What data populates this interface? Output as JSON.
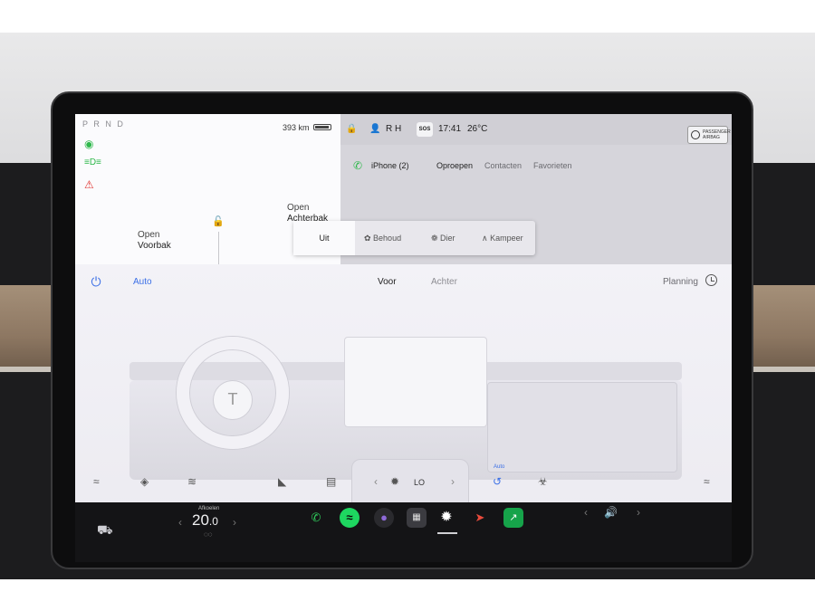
{
  "status": {
    "gears": "P R N D",
    "range": "393 km",
    "frunk": {
      "state": "Open",
      "name": "Voorbak"
    },
    "trunk": {
      "state": "Open",
      "name": "Achterbak"
    }
  },
  "top_bar": {
    "profile": "R H",
    "sos": "SOS",
    "time": "17:41",
    "outside_temp": "26°C",
    "airbag_label": "PASSENGER AIRBAG"
  },
  "phone": {
    "device": "iPhone (2)",
    "tabs": [
      "Oproepen",
      "Contacten",
      "Favorieten"
    ],
    "active_tab": "Oproepen"
  },
  "climate_keeper": {
    "options": [
      "Uit",
      "Behoud",
      "Dier",
      "Kampeer"
    ],
    "selected": "Uit"
  },
  "climate": {
    "auto_label": "Auto",
    "front_label": "Voor",
    "rear_label": "Achter",
    "planning_label": "Planning",
    "fan_speed": "LO",
    "auto_recirc_label": "Auto"
  },
  "taskbar": {
    "temp_label": "Afkoelen",
    "temp_value": "20",
    "temp_decimal": ".0"
  },
  "colors": {
    "accent_blue": "#3a6fe6",
    "green": "#2eb84b",
    "red_warning": "#e0312e",
    "taskbar": "#141416"
  }
}
